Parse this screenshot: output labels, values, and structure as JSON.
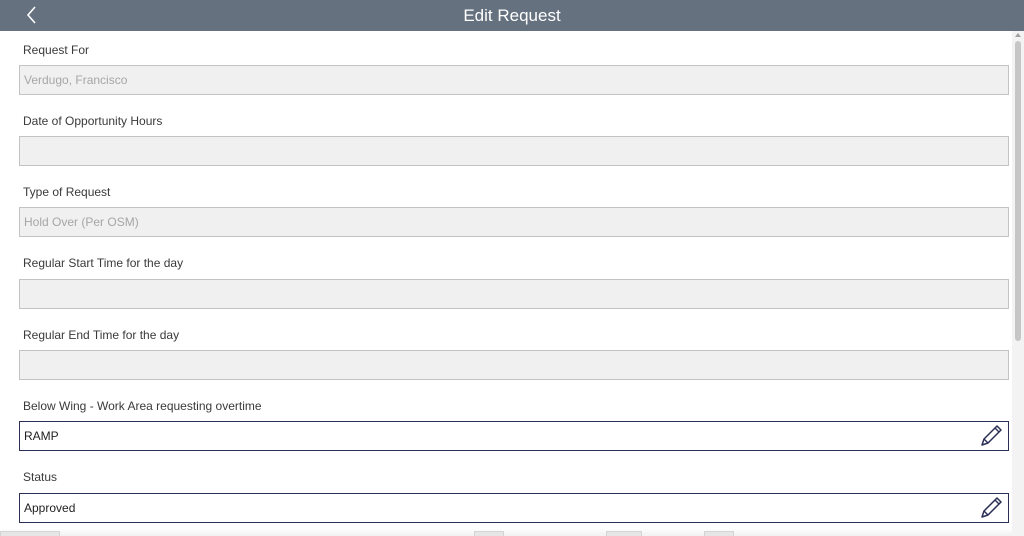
{
  "header": {
    "title": "Edit Request",
    "back_icon": "chevron-left-icon",
    "background": "#66717f"
  },
  "form": {
    "fields": [
      {
        "label": "Request For",
        "value": "Verdugo, Francisco",
        "editable": false
      },
      {
        "label": "Date of Opportunity Hours",
        "value": "",
        "editable": false
      },
      {
        "label": "Type of Request",
        "value": "Hold Over (Per OSM)",
        "editable": false
      },
      {
        "label": "Regular Start Time for the day",
        "value": "",
        "editable": false
      },
      {
        "label": "Regular End Time for the day",
        "value": "",
        "editable": false
      },
      {
        "label": "Below Wing - Work Area requesting overtime",
        "value": "RAMP",
        "editable": true,
        "icon": "pencil-icon"
      },
      {
        "label": "Status",
        "value": "Approved",
        "editable": true,
        "icon": "pencil-icon"
      }
    ]
  },
  "colors": {
    "editable_border": "#2a2f55",
    "disabled_background": "#f0f0f0",
    "disabled_text": "#a6a6a6"
  }
}
